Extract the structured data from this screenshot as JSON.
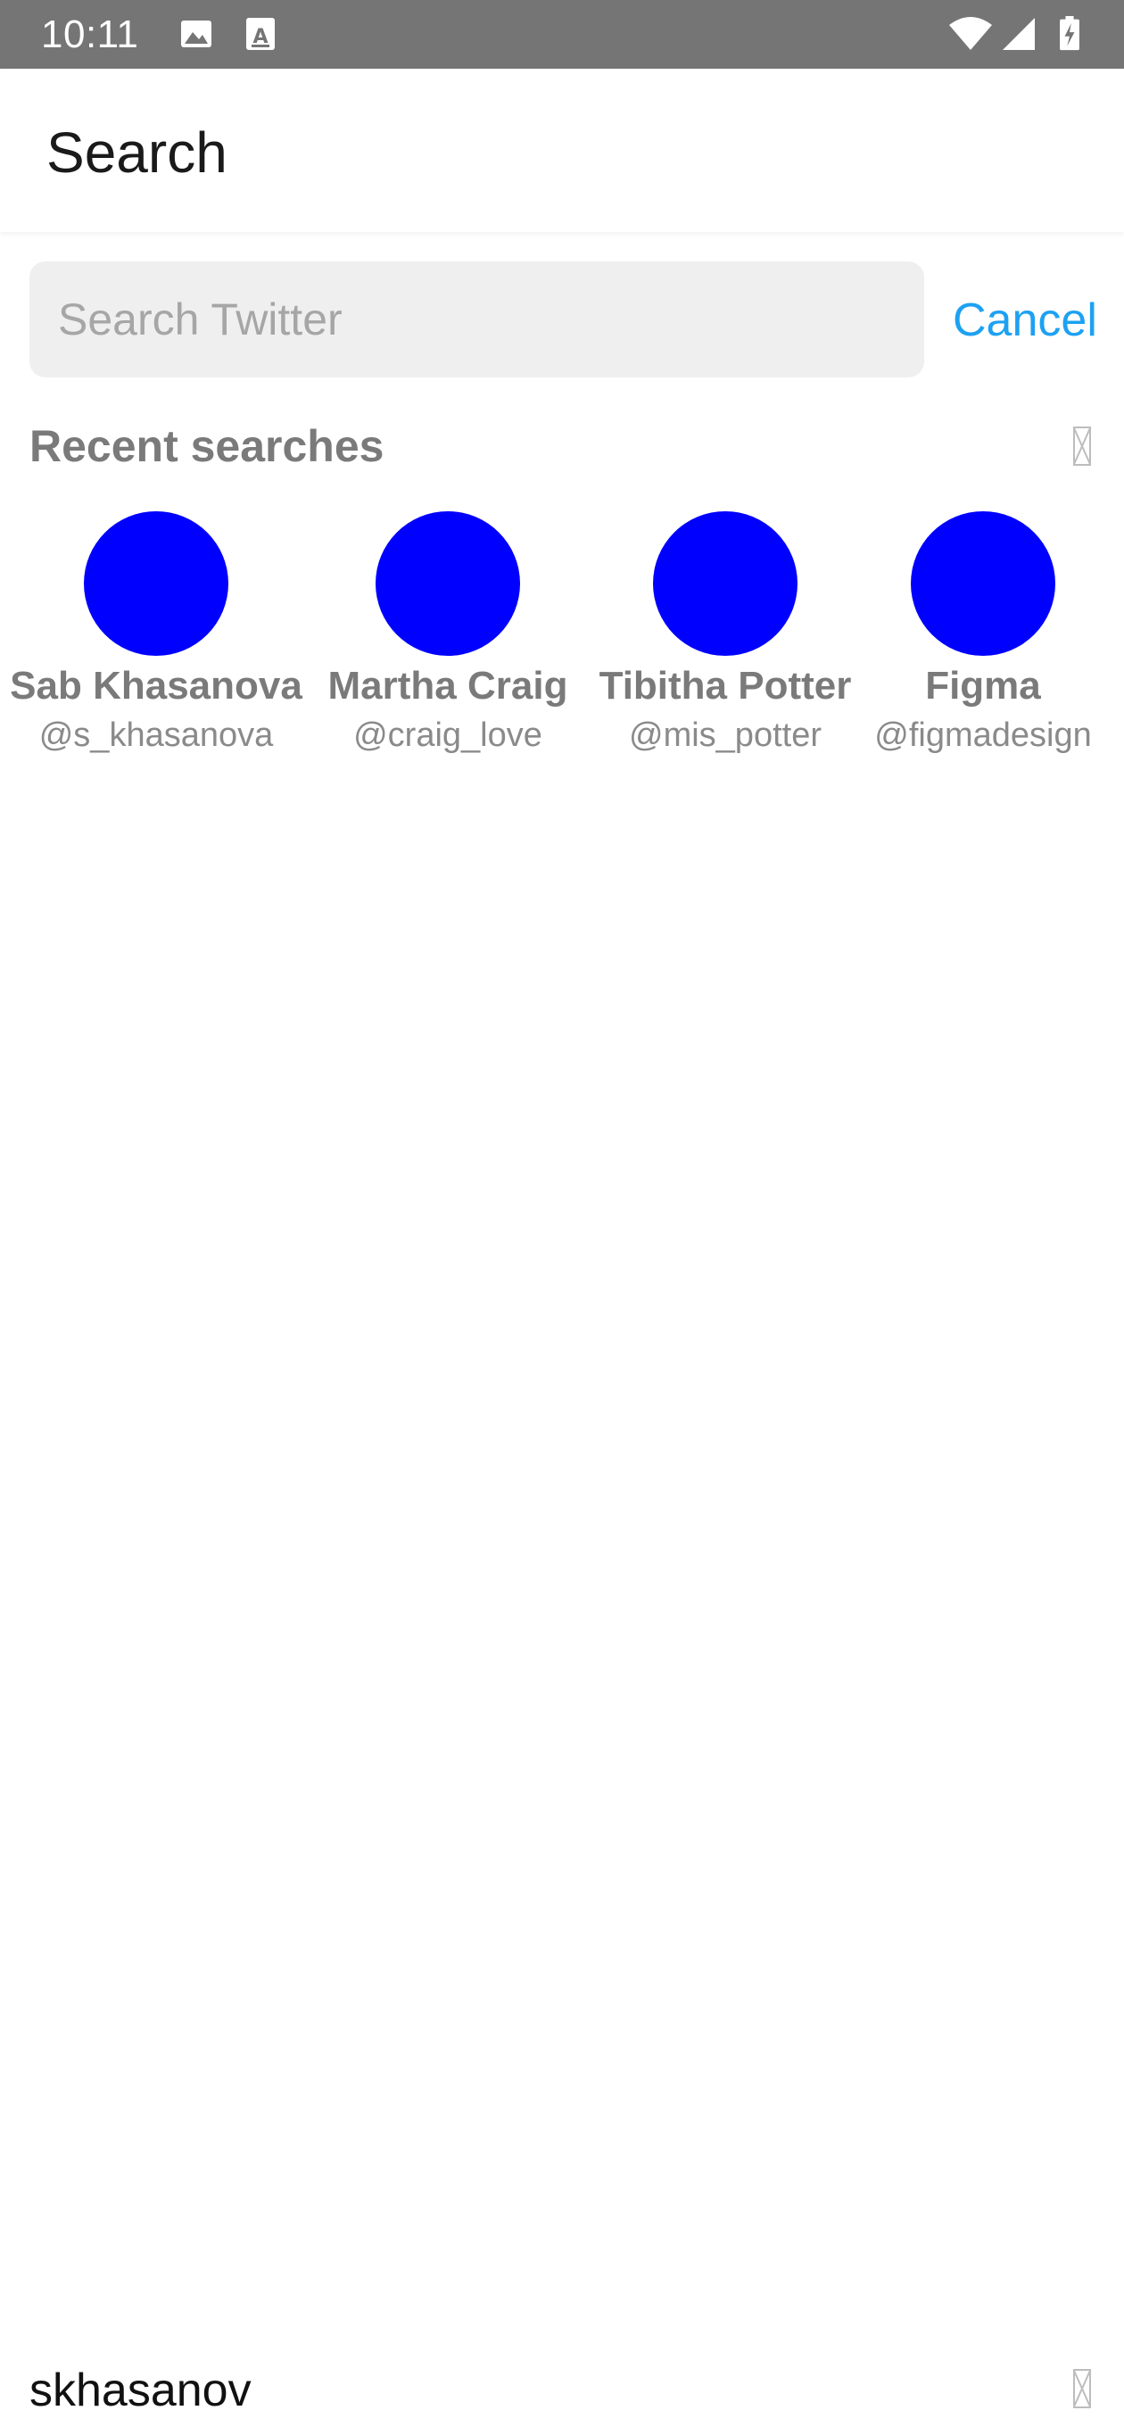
{
  "status_bar": {
    "time": "10:11",
    "left_icons": [
      "image-icon",
      "text-a-icon"
    ],
    "right_icons": [
      "wifi-icon",
      "cell-signal-icon",
      "battery-charging-icon"
    ]
  },
  "app_bar": {
    "title": "Search"
  },
  "search": {
    "placeholder": "Search Twitter",
    "value": "",
    "cancel_label": "Cancel"
  },
  "recent": {
    "title": "Recent searches",
    "clear_icon": "missing-glyph-icon",
    "users": [
      {
        "name": "Sab Khasanova",
        "handle": "@s_khasanova",
        "avatar_color": "#0000ff"
      },
      {
        "name": "Martha Craig",
        "handle": "@craig_love",
        "avatar_color": "#0000ff"
      },
      {
        "name": "Tibitha Potter",
        "handle": "@mis_potter",
        "avatar_color": "#0000ff"
      },
      {
        "name": "Figma",
        "handle": "@figmadesign",
        "avatar_color": "#0000ff"
      }
    ]
  },
  "account": {
    "username": "skhasanov",
    "menu_icon": "missing-glyph-icon"
  },
  "colors": {
    "status_bar_bg": "#757575",
    "accent": "#1da1f2",
    "search_bg": "#efefef",
    "avatar": "#0000ff",
    "muted_text": "#7a7a7a"
  }
}
